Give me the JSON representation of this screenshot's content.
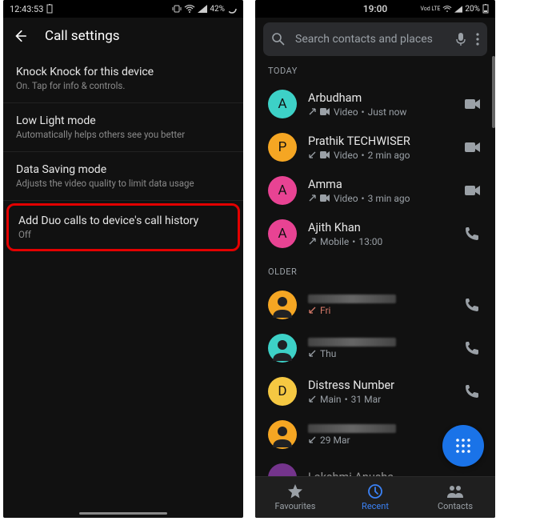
{
  "left": {
    "status": {
      "time": "12:43:53",
      "battery": "42%"
    },
    "header": {
      "title": "Call settings"
    },
    "rows": [
      {
        "primary": "Knock Knock for this device",
        "secondary": "On. Tap for info & controls."
      },
      {
        "primary": "Low Light mode",
        "secondary": "Automatically helps others see you better"
      },
      {
        "primary": "Data Saving mode",
        "secondary": "Adjusts the video quality to limit data usage"
      }
    ],
    "highlighted": {
      "primary": "Add Duo calls to device's call history",
      "secondary": "Off"
    }
  },
  "right": {
    "status": {
      "time": "19:00",
      "carrier": "Vod LTE",
      "battery": "20%"
    },
    "search": {
      "placeholder": "Search contacts and places"
    },
    "sections": {
      "today": "TODAY",
      "older": "OLDER"
    },
    "calls_today": [
      {
        "initial": "A",
        "color": "#3dd1c7",
        "name": "Arbudham",
        "dir": "out",
        "medium": "Video",
        "time": "Just now",
        "action": "video"
      },
      {
        "initial": "P",
        "color": "#f5a623",
        "name": "Prathik TECHWISER",
        "dir": "in",
        "medium": "Video",
        "time": "2 min ago",
        "action": "video"
      },
      {
        "initial": "A",
        "color": "#e84393",
        "name": "Amma",
        "dir": "out",
        "medium": "Video",
        "time": "3 min ago",
        "action": "video"
      },
      {
        "initial": "A",
        "color": "#e84393",
        "name": "Ajith Khan",
        "dir": "out",
        "medium": "Mobile",
        "time": "13:00",
        "action": "phone"
      }
    ],
    "calls_older": [
      {
        "icon": "person",
        "color": "#f5a623",
        "name_hidden": true,
        "dir": "missed",
        "time": "Fri",
        "action": "phone"
      },
      {
        "icon": "person",
        "color": "#3dd1c7",
        "name_hidden": true,
        "dir": "in",
        "time": "Thu",
        "action": "phone"
      },
      {
        "initial": "D",
        "color": "#f5c842",
        "name": "Distress Number",
        "dir": "in",
        "medium": "Main",
        "time": "31 Mar",
        "action": "phone"
      },
      {
        "icon": "person",
        "color": "#f5a623",
        "name_hidden": true,
        "dir": "in",
        "time": "29 Mar",
        "action": "phone"
      },
      {
        "initial": "",
        "color": "#b84ce0",
        "name": "Lakshmi Anusha",
        "dir": "",
        "time": "",
        "action": ""
      }
    ],
    "nav": {
      "favourites": "Favourites",
      "recent": "Recent",
      "contacts": "Contacts"
    }
  }
}
